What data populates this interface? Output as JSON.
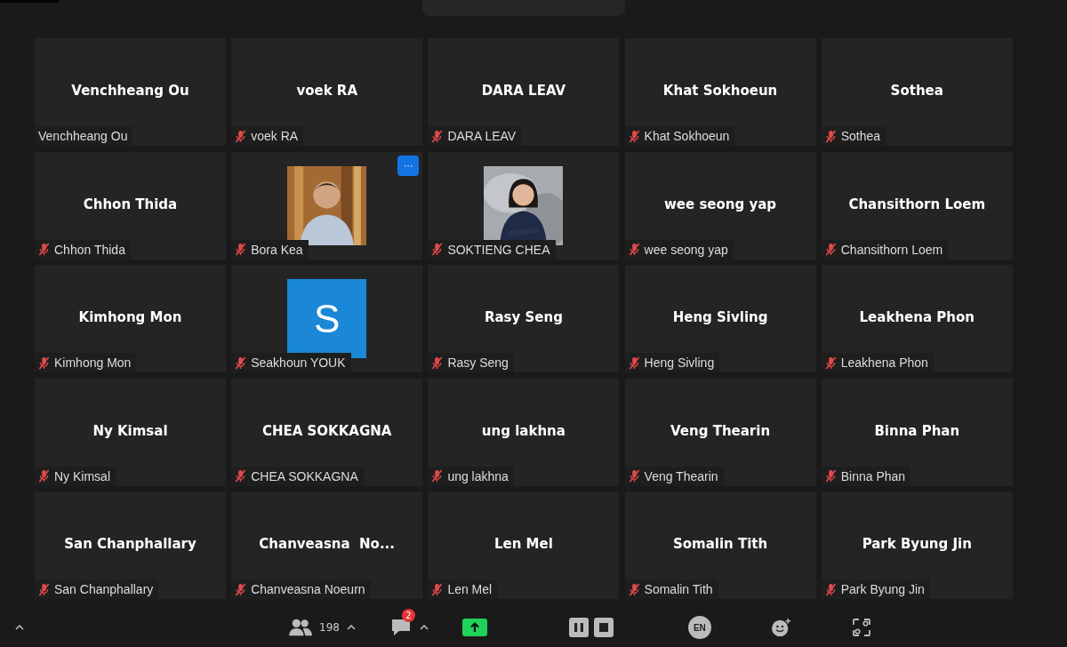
{
  "tiles": [
    {
      "kind": "name",
      "display": "Venchheang Ou",
      "label": "Venchheang Ou",
      "muted": false
    },
    {
      "kind": "name",
      "display": "voek RA",
      "label": "voek RA",
      "muted": true
    },
    {
      "kind": "name",
      "display": "DARA LEAV",
      "label": "DARA LEAV",
      "muted": true
    },
    {
      "kind": "name",
      "display": "Khat Sokhoeun",
      "label": "Khat Sokhoeun",
      "muted": true
    },
    {
      "kind": "name",
      "display": "Sothea",
      "label": "Sothea",
      "muted": true
    },
    {
      "kind": "name",
      "display": "Chhon Thida",
      "label": "Chhon Thida",
      "muted": true
    },
    {
      "label": "Bora Kea",
      "muted": true,
      "menu": "···"
    },
    {
      "label": "SOKTIENG CHEA",
      "muted": true
    },
    {
      "kind": "name",
      "display": "wee seong yap",
      "label": "wee seong yap",
      "muted": true
    },
    {
      "kind": "name",
      "display": "Chansithorn Loem",
      "label": "Chansithorn Loem",
      "muted": true
    },
    {
      "kind": "name",
      "display": "Kimhong Mon",
      "label": "Kimhong Mon",
      "muted": true
    },
    {
      "kind": "avatar",
      "letter": "S",
      "color": "#1a88d6",
      "label": "Seakhoun YOUK",
      "muted": true
    },
    {
      "kind": "name",
      "display": "Rasy Seng",
      "label": "Rasy Seng",
      "muted": true
    },
    {
      "kind": "name",
      "display": "Heng Sivling",
      "label": "Heng Sivling",
      "muted": true
    },
    {
      "kind": "name",
      "display": "Leakhena Phon",
      "label": "Leakhena Phon",
      "muted": true
    },
    {
      "kind": "name",
      "display": "Ny Kimsal",
      "label": "Ny Kimsal",
      "muted": true
    },
    {
      "kind": "name",
      "display": "CHEA SOKKAGNA",
      "label": "CHEA SOKKAGNA",
      "muted": true
    },
    {
      "kind": "name",
      "display": "ung lakhna",
      "label": "ung lakhna",
      "muted": true
    },
    {
      "kind": "name",
      "display": "Veng Thearin",
      "label": "Veng Thearin",
      "muted": true
    },
    {
      "kind": "name",
      "display": "Binna Phan",
      "label": "Binna Phan",
      "muted": true
    },
    {
      "kind": "name",
      "display": "San Chanphallary",
      "label": "San Chanphallary",
      "muted": true
    },
    {
      "kind": "name",
      "display": "Chanveasna  No...",
      "label": "Chanveasna Noeurn",
      "muted": true
    },
    {
      "kind": "name",
      "display": "Len Mel",
      "label": "Len Mel",
      "muted": true
    },
    {
      "kind": "name",
      "display": "Somalin Tith",
      "label": "Somalin Tith",
      "muted": true
    },
    {
      "kind": "name",
      "display": "Park Byung Jin",
      "label": "Park Byung Jin",
      "muted": true
    }
  ],
  "toolbar": {
    "participants_count": "198",
    "chat_badge": "2",
    "language": "EN"
  }
}
